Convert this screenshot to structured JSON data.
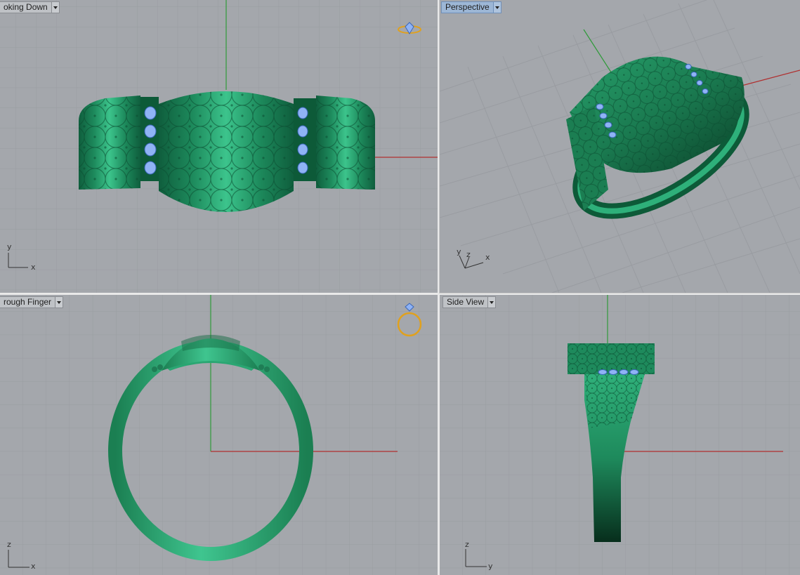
{
  "viewports": {
    "top_left": {
      "title": "oking Down"
    },
    "top_right": {
      "title": "Perspective"
    },
    "bottom_left": {
      "title": "rough Finger"
    },
    "bottom_right": {
      "title": "Side View"
    }
  },
  "axis_labels": {
    "top_left": {
      "vertical": "y",
      "horizontal": "x"
    },
    "top_right": {
      "a": "y",
      "b": "z",
      "c": "x"
    },
    "bottom_left": {
      "vertical": "z",
      "horizontal": "x"
    },
    "bottom_right": {
      "vertical": "z",
      "horizontal": "y"
    }
  },
  "icons": {
    "view_cube_top_left": "ring-preview-icon",
    "view_cube_bottom_left": "ring-with-gem-icon",
    "dropdown": "chevron-down-icon"
  },
  "colors": {
    "viewport_bg": "#a4a7ac",
    "grid_line": "#9a9da2",
    "grid_major": "#8e9196",
    "model_green": "#1f8f5f",
    "model_dark": "#0d5a38",
    "gem_blue": "#8fb3f5",
    "x_axis": "#b03030",
    "y_axis": "#2f9a3a",
    "active_title": "#9db7d6",
    "gizmo_gold": "#e0a11e"
  }
}
